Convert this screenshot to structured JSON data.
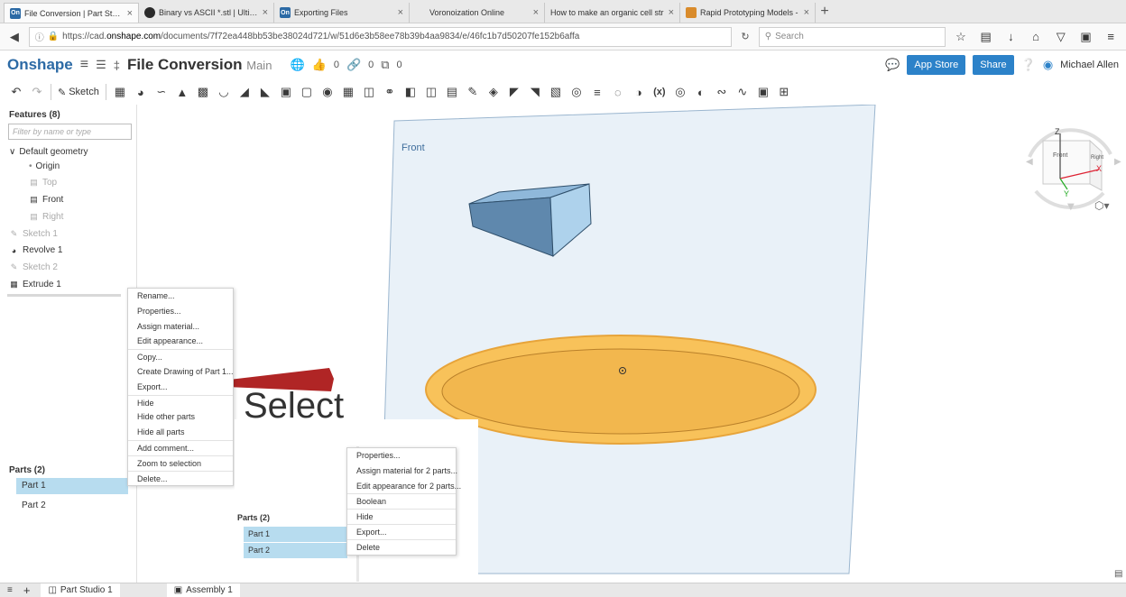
{
  "browser": {
    "tabs": [
      {
        "label": "File Conversion | Part Studio",
        "favicon": "onshape",
        "active": true
      },
      {
        "label": "Binary vs ASCII *.stl | Ultima",
        "favicon": "globe",
        "active": false
      },
      {
        "label": "Exporting Files",
        "favicon": "onshape",
        "active": false
      },
      {
        "label": "Voronoization Online",
        "favicon": "none",
        "active": false
      },
      {
        "label": "How to make an organic cell str",
        "favicon": "none",
        "active": false
      },
      {
        "label": "Rapid Prototyping Models -",
        "favicon": "image",
        "active": false
      }
    ],
    "favicon_text": "On",
    "close_glyph": "×",
    "new_tab_glyph": "+",
    "url_prefix": "https://cad.",
    "url_host": "onshape.com",
    "url_path": "/documents/7f72ea448bb53be38024d721/w/51d6e3b58ee78b39b4aa9834/e/46fc1b7d50207fe152b6affa",
    "search_placeholder": "Search"
  },
  "app": {
    "logo": "Onshape",
    "document_name": "File Conversion",
    "workspace": "Main",
    "likes": "0",
    "links": "0",
    "copies": "0",
    "app_store_label": "App Store",
    "share_label": "Share",
    "user_name": "Michael Allen"
  },
  "toolbar": {
    "sketch_label": "Sketch",
    "variable_label": "(x)"
  },
  "features": {
    "title": "Features (8)",
    "filter_placeholder": "Filter by name or type",
    "default_geometry": "Default geometry",
    "origin": "Origin",
    "top": "Top",
    "front": "Front",
    "right": "Right",
    "sketch1": "Sketch 1",
    "revolve1": "Revolve 1",
    "sketch2": "Sketch 2",
    "extrude1": "Extrude 1"
  },
  "parts": {
    "title": "Parts (2)",
    "items": [
      "Part 1",
      "Part 2"
    ]
  },
  "viewport": {
    "plane_label": "Front",
    "cube_front_label": "Front",
    "cube_right_label": "Right",
    "axis_z": "Z",
    "axis_x": "X",
    "axis_y": "Y",
    "colors": {
      "plane": "#e9f1f8",
      "box_top": "#8fb8da",
      "box_front": "#5f88ad",
      "box_right": "#aed2ec",
      "disc": "#f8c25a",
      "disc_dark": "#e7a43a"
    }
  },
  "context_menu_single": [
    "Rename...",
    "Properties...",
    "Assign material...",
    "Edit appearance...",
    "Copy...",
    "Create Drawing of Part 1...",
    "Export...",
    "Hide",
    "Hide other parts",
    "Hide all parts",
    "Add comment...",
    "Zoom to selection",
    "Delete..."
  ],
  "context_menu_multi": [
    "Properties...",
    "Assign material for 2 parts...",
    "Edit appearance for 2 parts...",
    "Boolean",
    "Hide",
    "Export...",
    "Delete"
  ],
  "annotation": {
    "select_label": "Select",
    "pointer_color": "#b02525"
  },
  "bottom": {
    "part_studio_tab": "Part Studio 1",
    "assembly_tab": "Assembly 1"
  }
}
